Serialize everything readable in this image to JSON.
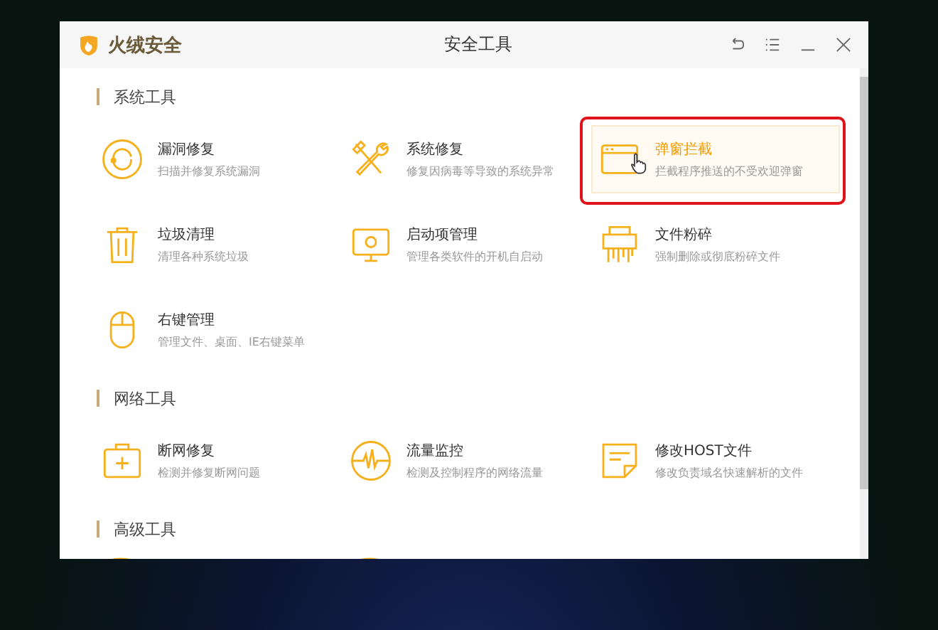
{
  "window": {
    "brand": "火绒安全",
    "title": "安全工具"
  },
  "sections": [
    {
      "title": "系统工具",
      "tools": [
        {
          "name": "漏洞修复",
          "description": "扫描并修复系统漏洞",
          "selected": false
        },
        {
          "name": "系统修复",
          "description": "修复因病毒等导致的系统异常",
          "selected": false
        },
        {
          "name": "弹窗拦截",
          "description": "拦截程序推送的不受欢迎弹窗",
          "selected": true
        },
        {
          "name": "垃圾清理",
          "description": "清理各种系统垃圾",
          "selected": false
        },
        {
          "name": "启动项管理",
          "description": "管理各类软件的开机自启动",
          "selected": false
        },
        {
          "name": "文件粉碎",
          "description": "强制删除或彻底粉碎文件",
          "selected": false
        },
        {
          "name": "右键管理",
          "description": "管理文件、桌面、IE右键菜单",
          "selected": false
        }
      ]
    },
    {
      "title": "网络工具",
      "tools": [
        {
          "name": "断网修复",
          "description": "检测并修复断网问题",
          "selected": false
        },
        {
          "name": "流量监控",
          "description": "检测及控制程序的网络流量",
          "selected": false
        },
        {
          "name": "修改HOST文件",
          "description": "修改负责域名快速解析的文件",
          "selected": false
        }
      ]
    },
    {
      "title": "高级工具"
    }
  ]
}
